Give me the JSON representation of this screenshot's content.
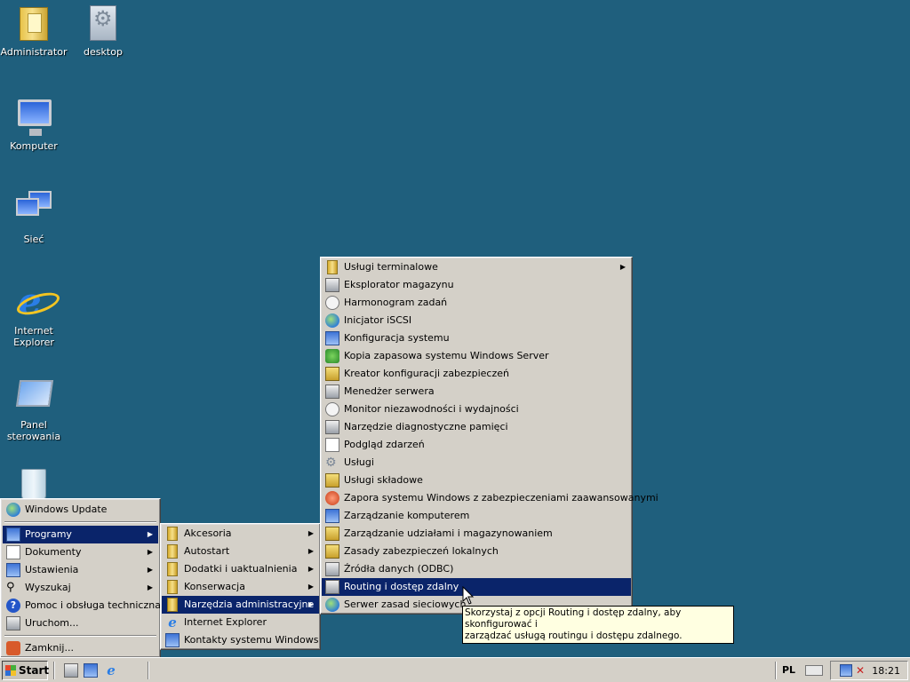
{
  "desktop_icons": [
    {
      "label": "Administrator",
      "icon": "user-folder-icon"
    },
    {
      "label": "desktop",
      "icon": "desktop-file-icon"
    },
    {
      "label": "Komputer",
      "icon": "computer-icon"
    },
    {
      "label": "Sieć",
      "icon": "network-icon"
    },
    {
      "label": "Internet Explorer",
      "icon": "internet-explorer-icon"
    },
    {
      "label": "Panel sterowania",
      "icon": "control-panel-icon"
    },
    {
      "label": "",
      "icon": "recycle-bin-icon"
    }
  ],
  "start_menu": {
    "top": {
      "label": "Windows Update",
      "icon": "windows-update-icon"
    },
    "items": [
      {
        "label": "Programy",
        "icon": "programs-icon",
        "submenu": true,
        "selected": true
      },
      {
        "label": "Dokumenty",
        "icon": "documents-icon",
        "submenu": true
      },
      {
        "label": "Ustawienia",
        "icon": "settings-icon",
        "submenu": true
      },
      {
        "label": "Wyszukaj",
        "icon": "search-icon",
        "submenu": true
      },
      {
        "label": "Pomoc i obsługa techniczna",
        "icon": "help-icon"
      },
      {
        "label": "Uruchom...",
        "icon": "run-icon"
      }
    ],
    "bottom": {
      "label": "Zamknij...",
      "icon": "shutdown-icon"
    }
  },
  "programs_menu": {
    "items": [
      {
        "label": "Akcesoria",
        "icon": "folder-icon",
        "submenu": true
      },
      {
        "label": "Autostart",
        "icon": "folder-icon",
        "submenu": true
      },
      {
        "label": "Dodatki i uaktualnienia",
        "icon": "folder-icon",
        "submenu": true
      },
      {
        "label": "Konserwacja",
        "icon": "folder-icon",
        "submenu": true
      },
      {
        "label": "Narzędzia administracyjne",
        "icon": "folder-icon",
        "submenu": true,
        "selected": true
      },
      {
        "label": "Internet Explorer",
        "icon": "internet-explorer-icon"
      },
      {
        "label": "Kontakty systemu Windows",
        "icon": "contacts-icon"
      }
    ]
  },
  "admin_tools_menu": {
    "items": [
      {
        "label": "Usługi terminalowe",
        "icon": "folder-icon",
        "submenu": true
      },
      {
        "label": "Eksplorator magazynu",
        "icon": "storage-explorer-icon"
      },
      {
        "label": "Harmonogram zadań",
        "icon": "task-scheduler-icon"
      },
      {
        "label": "Inicjator iSCSI",
        "icon": "iscsi-icon"
      },
      {
        "label": "Konfiguracja systemu",
        "icon": "system-config-icon"
      },
      {
        "label": "Kopia zapasowa systemu Windows Server",
        "icon": "backup-icon"
      },
      {
        "label": "Kreator konfiguracji zabezpieczeń",
        "icon": "security-wizard-icon"
      },
      {
        "label": "Menedżer serwera",
        "icon": "server-manager-icon"
      },
      {
        "label": "Monitor niezawodności i wydajności",
        "icon": "performance-monitor-icon"
      },
      {
        "label": "Narzędzie diagnostyczne pamięci",
        "icon": "memory-diagnostic-icon"
      },
      {
        "label": "Podgląd zdarzeń",
        "icon": "event-viewer-icon"
      },
      {
        "label": "Usługi",
        "icon": "services-icon"
      },
      {
        "label": "Usługi składowe",
        "icon": "component-services-icon"
      },
      {
        "label": "Zapora systemu Windows z zabezpieczeniami zaawansowanymi",
        "icon": "firewall-icon"
      },
      {
        "label": "Zarządzanie komputerem",
        "icon": "computer-management-icon"
      },
      {
        "label": "Zarządzanie udziałami i magazynowaniem",
        "icon": "share-management-icon"
      },
      {
        "label": "Zasady zabezpieczeń lokalnych",
        "icon": "local-policy-icon"
      },
      {
        "label": "Źródła danych (ODBC)",
        "icon": "odbc-icon"
      },
      {
        "label": "Routing i dostęp zdalny",
        "icon": "routing-icon",
        "selected": true
      },
      {
        "label": "Serwer zasad sieciowych",
        "icon": "nps-icon"
      }
    ]
  },
  "tooltip": {
    "line1": "Skorzystaj z opcji Routing i dostęp zdalny, aby skonfigurować i",
    "line2": "zarządzać usługą routingu i dostępu zdalnego."
  },
  "taskbar": {
    "start_label": "Start",
    "language": "PL",
    "clock": "18:21"
  }
}
